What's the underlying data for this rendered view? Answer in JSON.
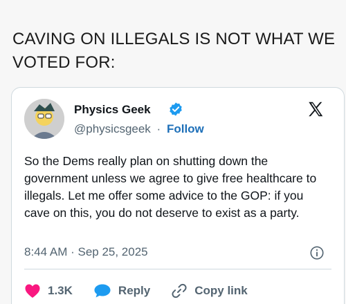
{
  "headline": "CAVING ON ILLEGALS IS NOT WHAT WE VOTED FOR:",
  "tweet": {
    "author_name": "Physics Geek",
    "handle": "@physicsgeek",
    "separator": "·",
    "follow_label": "Follow",
    "text": "So the Dems really plan on shutting down the government unless we agree to give free healthcare to illegals. Let me offer some advice to the GOP: if you cave on this, you do not deserve to exist as a party.",
    "timestamp": "8:44 AM · Sep 25, 2025",
    "likes_count": "1.3K",
    "reply_label": "Reply",
    "copy_link_label": "Copy link"
  },
  "colors": {
    "like": "#f91880",
    "reply": "#1d9bf0",
    "verified": "#1d9bf0",
    "follow": "#1d6fb8"
  },
  "icons": [
    "verified-badge-icon",
    "x-logo-icon",
    "info-icon",
    "heart-icon",
    "reply-bubble-icon",
    "link-icon"
  ]
}
